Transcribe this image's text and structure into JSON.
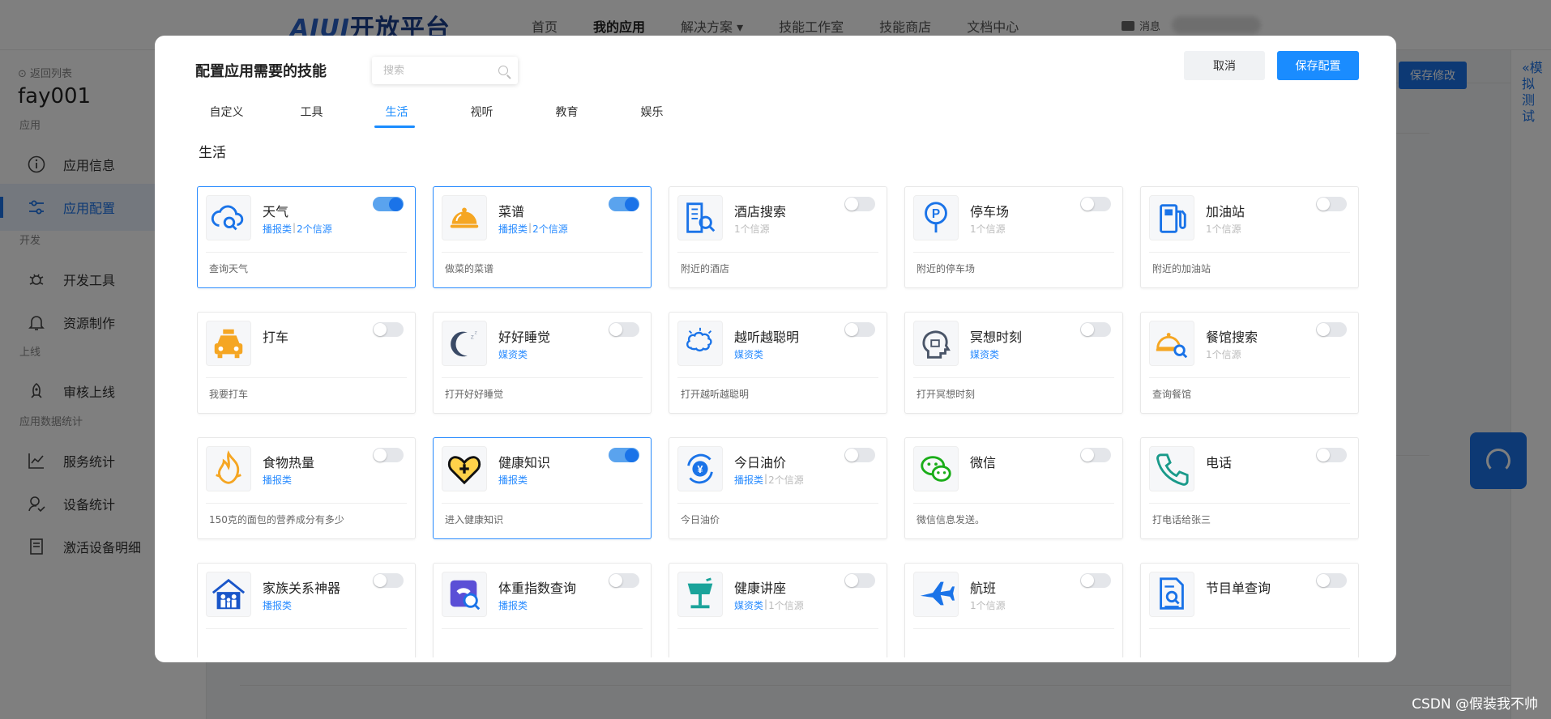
{
  "app": {
    "logo_ai": "AIUI",
    "logo_text": "开放平台",
    "nav": [
      "首页",
      "我的应用",
      "解决方案 ▾",
      "技能工作室",
      "技能商店",
      "文档中心"
    ],
    "messages_label": "消息",
    "back_link": "⊙ 返回列表",
    "app_name": "fay001",
    "sidebar_sections": [
      {
        "label": "应用",
        "items": [
          {
            "label": "应用信息",
            "icon": "info-icon"
          },
          {
            "label": "应用配置",
            "icon": "config-icon",
            "active": true
          }
        ]
      },
      {
        "label": "开发",
        "items": [
          {
            "label": "开发工具",
            "icon": "bug-icon"
          },
          {
            "label": "资源制作",
            "icon": "bell-icon"
          }
        ]
      },
      {
        "label": "上线",
        "items": [
          {
            "label": "审核上线",
            "icon": "rocket-icon"
          }
        ]
      },
      {
        "label": "应用数据统计",
        "items": [
          {
            "label": "服务统计",
            "icon": "chart-icon"
          },
          {
            "label": "设备统计",
            "icon": "device-icon"
          },
          {
            "label": "激活设备明细",
            "icon": "list-icon"
          }
        ]
      }
    ],
    "bg_save_label": "保存修改",
    "sim_label": "«模拟测试",
    "watermark": "CSDN @假装我不帅"
  },
  "modal": {
    "title": "配置应用需要的技能",
    "search_placeholder": "搜索",
    "cancel_label": "取消",
    "save_label": "保存配置",
    "tabs": [
      "自定义",
      "工具",
      "生活",
      "视听",
      "教育",
      "娱乐"
    ],
    "active_tab": "生活",
    "section_title": "生活",
    "skills": [
      {
        "name": "天气",
        "tags": [
          {
            "t": "播报类",
            "k": "tag"
          },
          {
            "t": "2个信源",
            "k": "tag"
          }
        ],
        "desc": "查询天气",
        "enabled": true,
        "icon": "cloud-search-icon"
      },
      {
        "name": "菜谱",
        "tags": [
          {
            "t": "播报类",
            "k": "tag"
          },
          {
            "t": "2个信源",
            "k": "tag"
          }
        ],
        "desc": "做菜的菜谱",
        "enabled": true,
        "icon": "cloche-icon"
      },
      {
        "name": "酒店搜索",
        "tags": [
          {
            "t": "1个信源",
            "k": "src"
          }
        ],
        "desc": "附近的酒店",
        "enabled": false,
        "icon": "hotel-search-icon"
      },
      {
        "name": "停车场",
        "tags": [
          {
            "t": "1个信源",
            "k": "src"
          }
        ],
        "desc": "附近的停车场",
        "enabled": false,
        "icon": "parking-icon"
      },
      {
        "name": "加油站",
        "tags": [
          {
            "t": "1个信源",
            "k": "src"
          }
        ],
        "desc": "附近的加油站",
        "enabled": false,
        "icon": "gas-pump-icon"
      },
      {
        "name": "打车",
        "tags": [],
        "desc": "我要打车",
        "enabled": false,
        "icon": "taxi-icon"
      },
      {
        "name": "好好睡觉",
        "tags": [
          {
            "t": "媒资类",
            "k": "tag"
          }
        ],
        "desc": "打开好好睡觉",
        "enabled": false,
        "icon": "moon-sleep-icon"
      },
      {
        "name": "越听越聪明",
        "tags": [
          {
            "t": "媒资类",
            "k": "tag"
          }
        ],
        "desc": "打开越听越聪明",
        "enabled": false,
        "icon": "brain-icon"
      },
      {
        "name": "冥想时刻",
        "tags": [
          {
            "t": "媒资类",
            "k": "tag"
          }
        ],
        "desc": "打开冥想时刻",
        "enabled": false,
        "icon": "head-icon"
      },
      {
        "name": "餐馆搜索",
        "tags": [
          {
            "t": "1个信源",
            "k": "src"
          }
        ],
        "desc": "查询餐馆",
        "enabled": false,
        "icon": "restaurant-search-icon"
      },
      {
        "name": "食物热量",
        "tags": [
          {
            "t": "播报类",
            "k": "tag"
          }
        ],
        "desc": "150克的面包的营养成分有多少",
        "enabled": false,
        "icon": "flame-icon"
      },
      {
        "name": "健康知识",
        "tags": [
          {
            "t": "播报类",
            "k": "tag"
          }
        ],
        "desc": "进入健康知识",
        "enabled": true,
        "icon": "heart-plus-icon"
      },
      {
        "name": "今日油价",
        "tags": [
          {
            "t": "播报类",
            "k": "tag"
          },
          {
            "t": "2个信源",
            "k": "src"
          }
        ],
        "desc": "今日油价",
        "enabled": false,
        "icon": "yuan-refresh-icon"
      },
      {
        "name": "微信",
        "tags": [],
        "desc": "微信信息发送。",
        "enabled": false,
        "icon": "wechat-icon"
      },
      {
        "name": "电话",
        "tags": [],
        "desc": "打电话给张三",
        "enabled": false,
        "icon": "phone-icon"
      },
      {
        "name": "家族关系神器",
        "tags": [
          {
            "t": "播报类",
            "k": "tag"
          }
        ],
        "desc": "",
        "enabled": false,
        "icon": "family-icon"
      },
      {
        "name": "体重指数查询",
        "tags": [
          {
            "t": "播报类",
            "k": "tag"
          }
        ],
        "desc": "",
        "enabled": false,
        "icon": "scale-search-icon"
      },
      {
        "name": "健康讲座",
        "tags": [
          {
            "t": "媒资类",
            "k": "tag"
          },
          {
            "t": "1个信源",
            "k": "src"
          }
        ],
        "desc": "",
        "enabled": false,
        "icon": "podium-icon"
      },
      {
        "name": "航班",
        "tags": [
          {
            "t": "1个信源",
            "k": "src"
          }
        ],
        "desc": "",
        "enabled": false,
        "icon": "airplane-icon"
      },
      {
        "name": "节目单查询",
        "tags": [],
        "desc": "",
        "enabled": false,
        "icon": "document-search-icon"
      }
    ]
  }
}
